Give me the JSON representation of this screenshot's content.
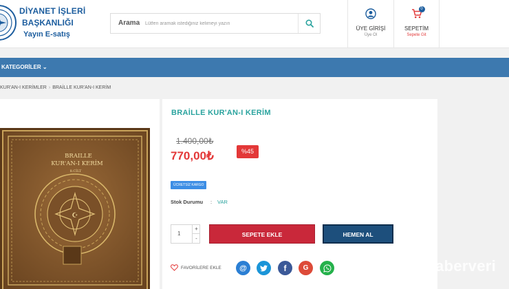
{
  "header": {
    "logo": {
      "line1": "DİYANET İŞLERİ",
      "line2": "BAŞKANLIĞI",
      "line3": "Yayın  E-satış"
    },
    "search": {
      "label": "Arama",
      "placeholder": "Lütfen aramak istediğiniz kelimeyi yazın",
      "icon": "search-icon"
    },
    "user": {
      "title": "ÜYE GİRİŞİ",
      "subtitle": "Üye Ol",
      "icon": "user-icon"
    },
    "cart": {
      "title": "SEPETİM",
      "subtitle": "Sepete Git",
      "count": "0",
      "icon": "cart-icon"
    }
  },
  "nav": {
    "categories_label": "KATEGORİLER ⌄"
  },
  "breadcrumb": [
    "KUR'AN-I KERİMLER",
    "BRAİLLE KUR'AN-I KERİM"
  ],
  "product": {
    "title": "BRAİLLE KUR'AN-I KERİM",
    "old_price": "1.400,00₺",
    "new_price": "770,00₺",
    "discount": "%45",
    "cargo_badge": "ÜCRETSİZ KARGO",
    "stock_label": "Stok Durumu",
    "stock_colon": ":",
    "stock_value": "VAR",
    "quantity": "1",
    "qty_plus": "+",
    "qty_minus": "-",
    "add_to_cart": "SEPETE EKLE",
    "buy_now": "HEMEN AL",
    "favorite_label": "FAVORİLERE EKLE",
    "book_cover": {
      "line1": "BRAILLE",
      "line2": "KUR'AN-I KERİM",
      "line3": "8.CİLT"
    }
  },
  "share": [
    {
      "name": "mail",
      "glyph": "@"
    },
    {
      "name": "twitter",
      "glyph": ""
    },
    {
      "name": "facebook",
      "glyph": "f"
    },
    {
      "name": "google",
      "glyph": "G"
    },
    {
      "name": "whatsapp",
      "glyph": ""
    }
  ],
  "watermark": "aberveri",
  "colors": {
    "brand_blue": "#1c5d9e",
    "nav_blue": "#3d79af",
    "accent_teal": "#2aa39e",
    "price_red": "#e33838",
    "cart_red": "#c9283a",
    "buy_navy": "#1d4f7c"
  }
}
